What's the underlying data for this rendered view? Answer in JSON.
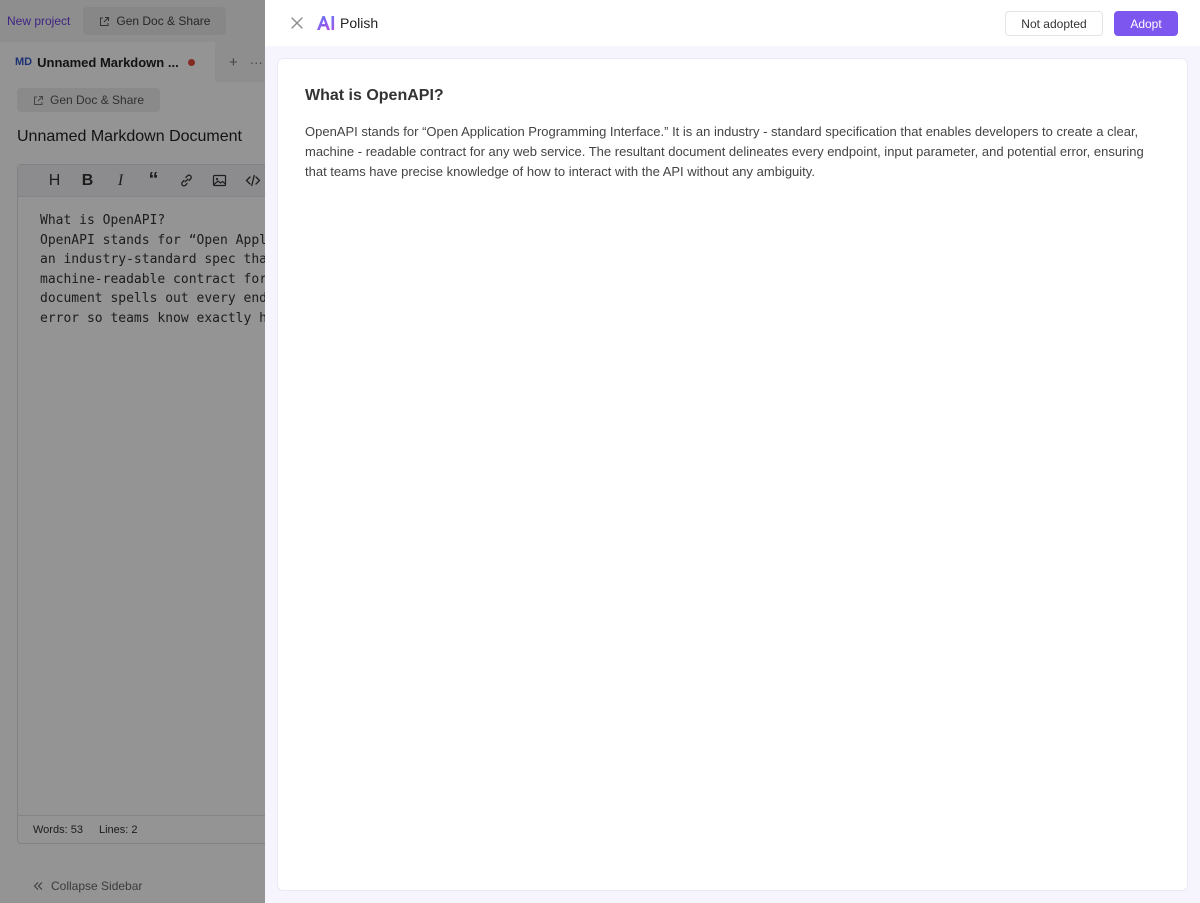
{
  "app": {
    "new_project_label": "New project",
    "gen_doc_share_label": "Gen Doc & Share",
    "tab": {
      "badge": "MD",
      "title": "Unnamed Markdown ...",
      "plus": "+",
      "more": "···"
    },
    "editor": {
      "gen_doc_share_label": "Gen Doc & Share",
      "document_title": "Unnamed Markdown Document",
      "toolbar": [
        "H",
        "B",
        "I",
        "“",
        "link-icon",
        "image-icon",
        "code-icon"
      ],
      "content_lines": [
        "What is OpenAPI?",
        "OpenAPI stands for “Open Appl",
        "an industry‐standard spec tha",
        "machine‐readable contract for",
        "document spells out every end",
        "error so teams know exactly h"
      ],
      "status": {
        "words_label": "Words:",
        "words_value": "53",
        "lines_label": "Lines:",
        "lines_value": "2"
      },
      "collapse_sidebar_label": "Collapse Sidebar"
    }
  },
  "drawer": {
    "title": "Polish",
    "not_adopted_label": "Not adopted",
    "adopt_label": "Adopt",
    "heading": "What is OpenAPI?",
    "body": "OpenAPI stands for “Open Application Programming Interface.” It is an industry - standard specification that enables developers to create a clear, machine - readable contract for any web service. The resultant document delineates every endpoint, input parameter, and potential error, ensuring that teams have precise knowledge of how to interact with the API without any ambiguity."
  },
  "colors": {
    "accent": "#7d55ef",
    "dirty_dot": "#e04a3a",
    "md_badge": "#3357c8"
  }
}
